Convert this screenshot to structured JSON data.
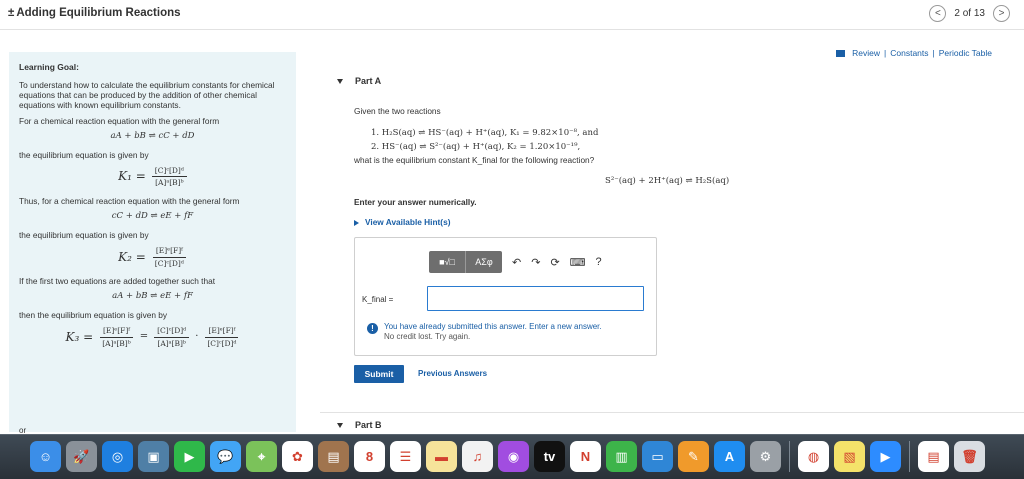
{
  "header": {
    "title_icon": "±",
    "title": "Adding Equilibrium Reactions",
    "prev_label": "<",
    "next_label": ">",
    "page_indicator": "2 of 13"
  },
  "links": {
    "review": "Review",
    "constants": "Constants",
    "periodic_table": "Periodic Table",
    "separator": "|"
  },
  "learning_goal": {
    "heading": "Learning Goal:",
    "intro": "To understand how to calculate the equilibrium constants for chemical equations that can be produced by the addition of other chemical equations with known equilibrium constants.",
    "general_form_text": "For a chemical reaction equation with the general form",
    "eq1": "aA + bB ⇌ cC + dD",
    "given_by_1": "the equilibrium equation is given by",
    "k1_label": "K₁ =",
    "k1_num": "[C]ᶜ[D]ᵈ",
    "k1_den": "[A]ᵃ[B]ᵇ",
    "thus_text": "Thus, for a chemical reaction equation with the general form",
    "eq2": "cC + dD ⇌ eE + fF",
    "given_by_2": "the equilibrium equation is given by",
    "k2_label": "K₂ =",
    "k2_num": "[E]ᵉ[F]ᶠ",
    "k2_den": "[C]ᶜ[D]ᵈ",
    "added_text": "If the first two equations are added together such that",
    "eq3": "aA + bB ⇌ eE + fF",
    "given_by_3": "then the equilibrium equation is given by",
    "k3_label": "K₃ =",
    "k3_num_a": "[E]ᵉ[F]ᶠ",
    "k3_den_a": "[A]ᵃ[B]ᵇ",
    "k3_num_b": "[C]ᶜ[D]ᵈ",
    "k3_den_b": "[A]ᵃ[B]ᵇ",
    "k3_num_c": "[E]ᵉ[F]ᶠ",
    "k3_den_c": "[C]ᶜ[D]ᵈ",
    "equals": "=",
    "dot": "·",
    "or": "or"
  },
  "part_a": {
    "label": "Part A",
    "given": "Given the two reactions",
    "reaction1": "1. H₂S(aq) ⇌ HS⁻(aq) + H⁺(aq),   K₁ = 9.82×10⁻⁸, and",
    "reaction2": "2. HS⁻(aq) ⇌ S²⁻(aq) + H⁺(aq),   K₂ = 1.20×10⁻¹⁹,",
    "question": "what is the equilibrium constant K_final for the following reaction?",
    "final_reaction": "S²⁻(aq) + 2H⁺(aq) ⇌ H₂S(aq)",
    "enter_prompt": "Enter your answer numerically.",
    "hints_link": "View Available Hint(s)",
    "toolbar": {
      "templates": "■√□",
      "greek": "ΑΣφ",
      "undo": "↶",
      "redo": "↷",
      "reset": "⟳",
      "keyboard": "⌨",
      "help": "?"
    },
    "answer_label": "K_final = ",
    "answer_value": "",
    "warning_icon": "!",
    "warning_line1": "You have already submitted this answer. Enter a new answer.",
    "warning_line2": "No credit lost. Try again.",
    "submit_label": "Submit",
    "previous_answers": "Previous Answers"
  },
  "part_b": {
    "label": "Part B"
  },
  "dock": [
    {
      "name": "finder",
      "color": "#3b8ee8",
      "glyph": "☺"
    },
    {
      "name": "launchpad",
      "color": "#8a9199",
      "glyph": "🚀"
    },
    {
      "name": "safari",
      "color": "#1e7fe0",
      "glyph": "◎"
    },
    {
      "name": "preview",
      "color": "#4f7fa6",
      "glyph": "▣"
    },
    {
      "name": "facetime",
      "color": "#2fb84a",
      "glyph": "▶"
    },
    {
      "name": "messages",
      "color": "#42a5f5",
      "glyph": "💬"
    },
    {
      "name": "maps",
      "color": "#7bc25a",
      "glyph": "⌖"
    },
    {
      "name": "photos",
      "color": "#ffffff",
      "glyph": "✿"
    },
    {
      "name": "notebook",
      "color": "#a0744e",
      "glyph": "▤"
    },
    {
      "name": "calendar",
      "color": "#ffffff",
      "glyph": "8"
    },
    {
      "name": "reminders",
      "color": "#ffffff",
      "glyph": "☰"
    },
    {
      "name": "notes",
      "color": "#f6e39a",
      "glyph": "▬"
    },
    {
      "name": "music",
      "color": "#f2f2f2",
      "glyph": "♫"
    },
    {
      "name": "podcasts",
      "color": "#a14de0",
      "glyph": "◉"
    },
    {
      "name": "tv",
      "color": "#111111",
      "glyph": "tv"
    },
    {
      "name": "news",
      "color": "#ffffff",
      "glyph": "N"
    },
    {
      "name": "numbers",
      "color": "#3db44a",
      "glyph": "▥"
    },
    {
      "name": "keynote",
      "color": "#2f86d6",
      "glyph": "▭"
    },
    {
      "name": "pages",
      "color": "#f09a2b",
      "glyph": "✎"
    },
    {
      "name": "app-store",
      "color": "#1f8df0",
      "glyph": "A"
    },
    {
      "name": "system-preferences",
      "color": "#9aa0a6",
      "glyph": "⚙"
    },
    {
      "name": "chrome",
      "color": "#ffffff",
      "glyph": "◍"
    },
    {
      "name": "stickies",
      "color": "#f4e26a",
      "glyph": "▧"
    },
    {
      "name": "zoom",
      "color": "#2d8cff",
      "glyph": "▶"
    },
    {
      "name": "document",
      "color": "#ffffff",
      "glyph": "▤"
    },
    {
      "name": "trash",
      "color": "#d9dde2",
      "glyph": "🗑"
    }
  ]
}
